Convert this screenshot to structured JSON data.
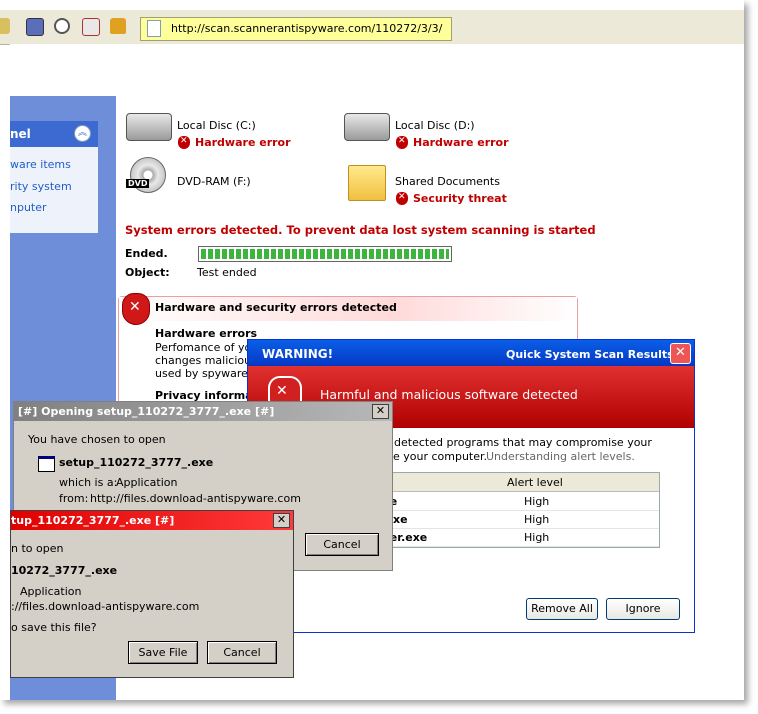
{
  "browser": {
    "address_url": "http://scan.scannerantispyware.com/110272/3/3/"
  },
  "sidebar": {
    "title": "nel",
    "items": [
      {
        "label": "ware items"
      },
      {
        "label": "rity system"
      },
      {
        "label": "nputer"
      }
    ]
  },
  "drives": [
    {
      "name": "Local Disc (C:)",
      "status": "Hardware error"
    },
    {
      "name": "Local Disc (D:)",
      "status": "Hardware error"
    },
    {
      "name": "DVD-RAM (F:)",
      "icon_label": "DVD",
      "status": ""
    },
    {
      "name": "Shared Documents",
      "status": "Security threat"
    }
  ],
  "scan": {
    "headline": "System errors detected. To prevent data lost system scanning is started",
    "ended_label": "Ended.",
    "object_label": "Object:",
    "object_value": "Test ended",
    "progress": 1.0
  },
  "alert": {
    "title": "Hardware and security errors detected",
    "hw_title": "Hardware errors",
    "hw_text1": "Perfomance of you",
    "hw_text2": "changes malicious",
    "hw_text3": "used by spyware to",
    "privacy_title": "Privacy informat"
  },
  "warning": {
    "title": "WARNING!",
    "subtitle": "Quick System Scan Results",
    "close": "✕",
    "banner": "Harmful and malicious software detected",
    "desc1": "r detected programs that may compromise your",
    "desc2": "ge your computer.",
    "desc_link": "Understanding alert levels.",
    "col_level": "Alert level",
    "rows": [
      {
        "name": ".exe",
        "level": "High"
      },
      {
        "name": "sr.exe",
        "level": "High"
      },
      {
        "name": "asfer.exe",
        "level": "High"
      }
    ],
    "remove_label": "Remove All",
    "ignore_label": "Ignore"
  },
  "open_dialog": {
    "title": "[#] Opening setup_110272_3777_.exe [#]",
    "close": "✕",
    "chosen": "You have chosen to open",
    "filename": "setup_110272_3777_.exe",
    "which_label": "which is a:",
    "which_value": "Application",
    "from_label": "from:",
    "from_value": "http://files.download-antispyware.com",
    "cancel_label": "Cancel"
  },
  "save_dialog": {
    "title": "tup_110272_3777_.exe [#]",
    "close": "✕",
    "chosen": "n to open",
    "filename": "10272_3777_.exe",
    "type": "Application",
    "from": "://files.download-antispyware.com",
    "question": "o save this file?",
    "save_label": "Save File",
    "cancel_label": "Cancel"
  }
}
